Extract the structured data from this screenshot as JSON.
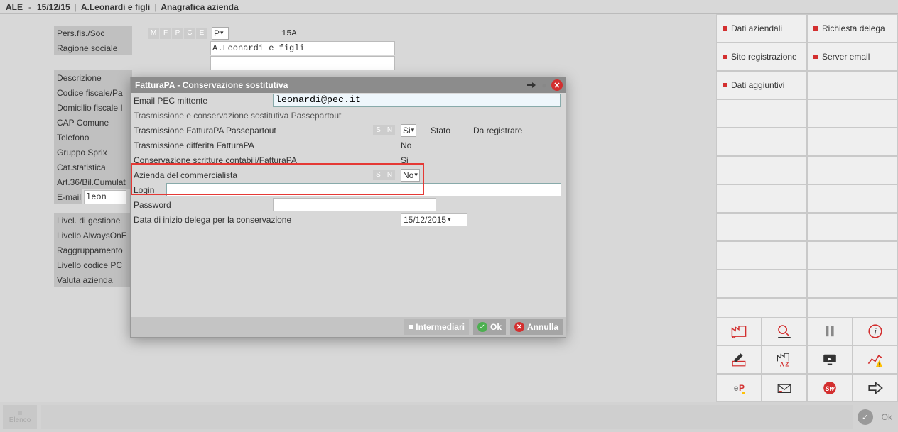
{
  "breadcrumb": {
    "code": "ALE",
    "date": "15/12/15",
    "company": "A.Leonardi e figli",
    "section": "Anagrafica azienda"
  },
  "bg": {
    "pers_fis_soc": {
      "label": "Pers.fis./Soc",
      "val": "P",
      "code": "15A"
    },
    "ragione_sociale": {
      "label": "Ragione sociale",
      "val": "A.Leonardi e figli"
    },
    "descrizione": {
      "label": "Descrizione"
    },
    "codice_fiscale": {
      "label": "Codice fiscale/Pa"
    },
    "domicilio": {
      "label": "Domicilio fiscale I"
    },
    "cap_comune": {
      "label": "CAP   Comune"
    },
    "telefono": {
      "label": "Telefono"
    },
    "gruppo_sprix": {
      "label": "Gruppo Sprix"
    },
    "cat_stat": {
      "label": "Cat.statistica"
    },
    "art36": {
      "label": "Art.36/Bil.Cumulat"
    },
    "email": {
      "label": "E-mail",
      "val": "leon"
    },
    "livgest": {
      "label": "Livel. di gestione"
    },
    "livaoe": {
      "label": "Livello AlwaysOnE"
    },
    "ragg": {
      "label": "Raggruppamento"
    },
    "livpc": {
      "label": "Livello codice PC"
    },
    "valuta": {
      "label": "Valuta azienda"
    }
  },
  "dialog": {
    "title": "FatturaPA - Conservazione sostitutiva",
    "email_pec": {
      "label": "Email PEC mittente",
      "val": "leonardi@pec.it"
    },
    "section_trasm": "Trasmissione e conservazione sostitutiva Passepartout",
    "trasm_fpa": {
      "label": "Trasmissione FatturaPA Passepartout",
      "val": "Si",
      "stato_lbl": "Stato",
      "stato_val": "Da registrare"
    },
    "trasm_diff": {
      "label": "Trasmissione differita FatturaPA",
      "val": "No"
    },
    "cons_scritt": {
      "label": "Conservazione scritture contabili/FatturaPA",
      "val": "Si"
    },
    "az_comm": {
      "label": "Azienda del commercialista",
      "val": "No"
    },
    "login": {
      "label": "Login"
    },
    "password": {
      "label": "Password"
    },
    "data_inizio": {
      "label": "Data di inizio delega per la conservazione",
      "val": "15/12/2015"
    },
    "btn_intermediari": "Intermediari",
    "btn_ok": "Ok",
    "btn_annulla": "Annulla"
  },
  "right": {
    "dati_aziendali": "Dati aziendali",
    "richiesta_delega": "Richiesta delega",
    "sito_reg": "Sito registrazione",
    "server_email": "Server email",
    "dati_agg": "Dati aggiuntivi"
  },
  "bottom": {
    "elenco": "Elenco",
    "ok": "Ok"
  },
  "letters": {
    "m": "M",
    "f": "F",
    "p": "P",
    "c": "C",
    "e": "E",
    "s": "S",
    "n": "N"
  }
}
